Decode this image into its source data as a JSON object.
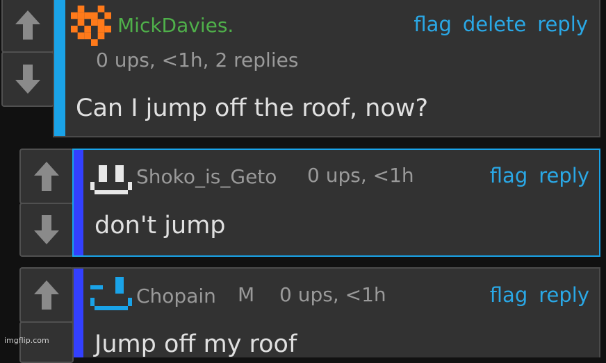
{
  "colors": {
    "background": "#111111",
    "panel": "#323232",
    "link": "#2aa8e6",
    "op_accent": "#1aa3e8",
    "reply_accent": "#3340ff",
    "op_username": "#4fb04a",
    "reply_username": "#9a9a9a",
    "text": "#e0e0e0",
    "meta": "#9a9a9a"
  },
  "comments": [
    {
      "username": "MickDavies.",
      "meta": "0 ups, <1h, 2 replies",
      "text": "Can I jump off the roof, now?",
      "actions": [
        "flag",
        "delete",
        "reply"
      ],
      "avatar_icon": "orange-pixel-avatar-icon"
    },
    {
      "username": "Shoko_is_Geto",
      "meta": "0 ups, <1h",
      "text": "don't jump",
      "actions": [
        "flag",
        "reply"
      ],
      "avatar_icon": "white-pixel-face-avatar-icon"
    },
    {
      "username": "Chopain",
      "badge": "M",
      "meta": "0 ups, <1h",
      "text": "Jump off my roof",
      "actions": [
        "flag",
        "reply"
      ],
      "avatar_icon": "blue-pixel-face-avatar-icon"
    }
  ],
  "watermark": "imgflip.com"
}
